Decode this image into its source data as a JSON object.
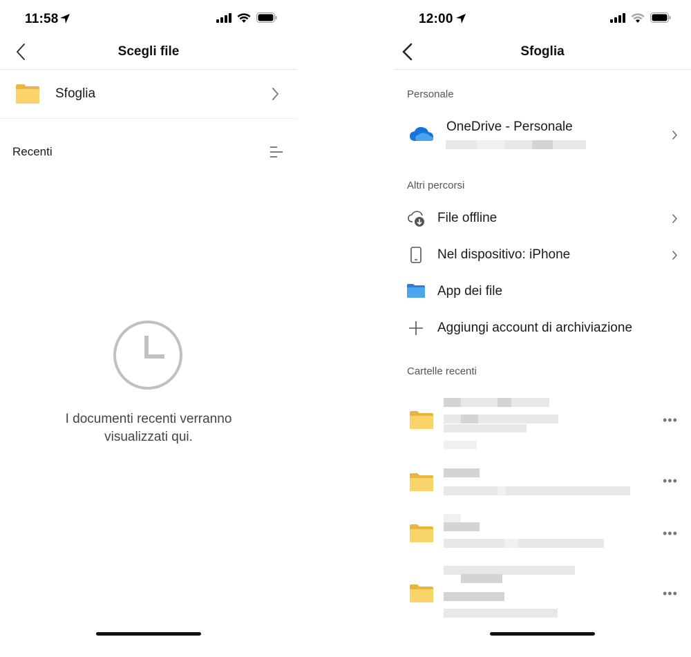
{
  "left": {
    "status_time": "11:58",
    "nav_title": "Scegli file",
    "browse_label": "Sfoglia",
    "recent_label": "Recenti",
    "empty_line1": "I documenti recenti verranno",
    "empty_line2": "visualizzati qui."
  },
  "right": {
    "status_time": "12:00",
    "nav_title": "Sfoglia",
    "personal_section": "Personale",
    "onedrive_label": "OneDrive - Personale",
    "other_section": "Altri percorsi",
    "items": [
      {
        "label": "File offline",
        "icon": "cloud-download-icon"
      },
      {
        "label": "Nel dispositivo: iPhone",
        "icon": "phone-icon"
      },
      {
        "label": "App dei file",
        "icon": "folder-blue-icon"
      },
      {
        "label": "Aggiungi account di archiviazione",
        "icon": "plus-icon"
      }
    ],
    "recent_folders_section": "Cartelle recenti"
  },
  "colors": {
    "folder_yellow": "#f6cf5f",
    "folder_blue": "#3a8ee6",
    "onedrive_blue": "#1a73d9"
  }
}
